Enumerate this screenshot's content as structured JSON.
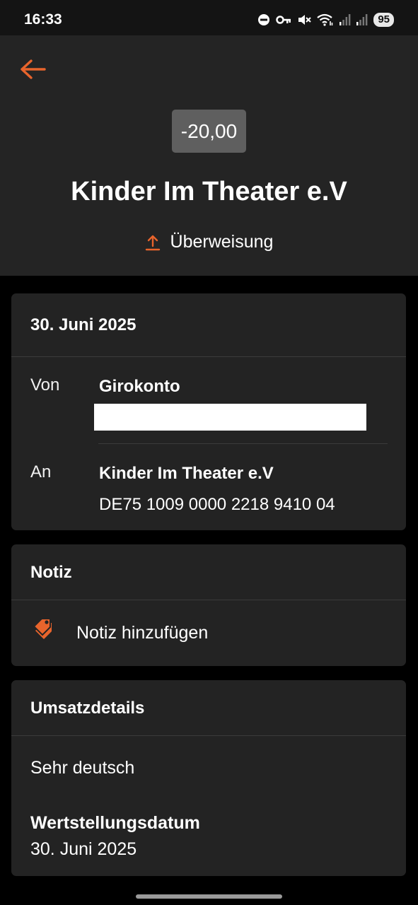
{
  "status_bar": {
    "time": "16:33",
    "battery": "95",
    "icons": [
      "do-not-disturb-icon",
      "vpn-key-icon",
      "mute-icon",
      "wifi-icon",
      "signal-icon",
      "signal-icon"
    ]
  },
  "colors": {
    "accent": "#e8642c",
    "header_bg": "#242424",
    "card_bg": "#232323",
    "page_bg": "#000000",
    "amount_bg": "#5f5f5f"
  },
  "header": {
    "amount": "-20,00",
    "payee": "Kinder Im Theater e.V",
    "type_label": "Überweisung"
  },
  "transfer_card": {
    "date": "30. Juni 2025",
    "from_label": "Von",
    "from_account": "Girokonto",
    "to_label": "An",
    "to_name": "Kinder Im Theater e.V",
    "to_iban": "DE75 1009 0000 2218 9410 04"
  },
  "note_card": {
    "title": "Notiz",
    "add_label": "Notiz hinzufügen"
  },
  "details_card": {
    "title": "Umsatzdetails",
    "description": "Sehr deutsch",
    "value_date_label": "Wertstellungsdatum",
    "value_date": "30. Juni 2025"
  }
}
